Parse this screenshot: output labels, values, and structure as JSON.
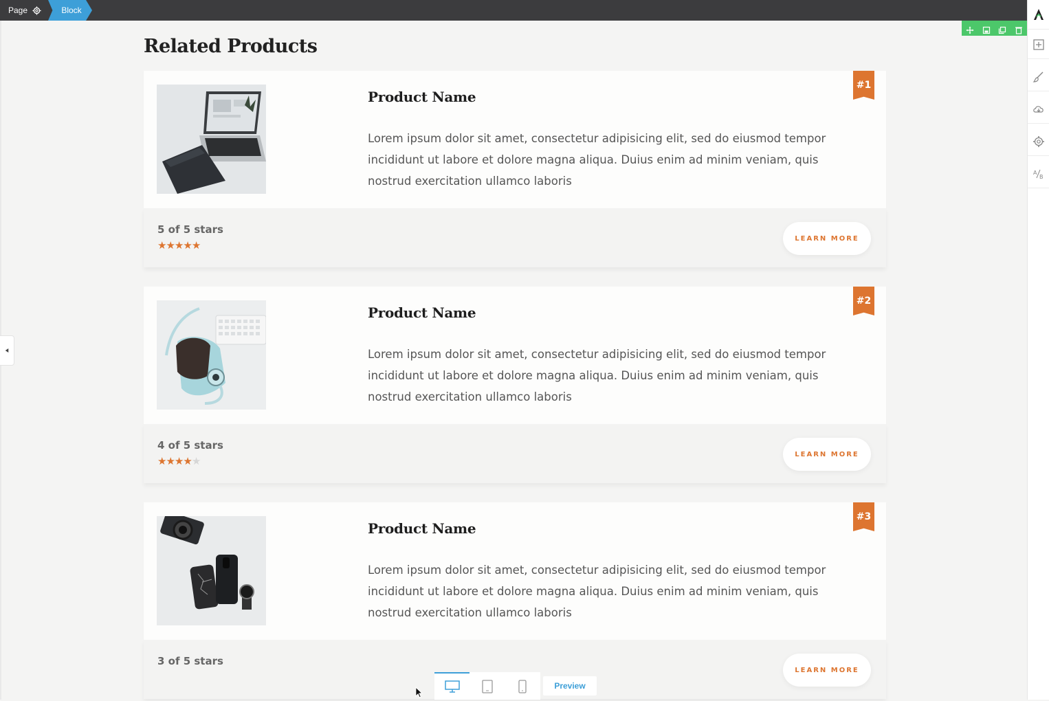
{
  "topbar": {
    "page_label": "Page",
    "block_label": "Block"
  },
  "section": {
    "title": "Related Products"
  },
  "products": [
    {
      "rank": "#1",
      "name": "Product Name",
      "description": "Lorem ipsum dolor sit amet, consectetur adipisicing elit, sed do eiusmod tempor incididunt ut labore et dolore magna aliqua. Duius enim ad minim veniam, quis nostrud exercitation ullamco laboris",
      "rating_label": "5 of 5 stars",
      "rating": 5,
      "max_rating": 5,
      "button": "LEARN MORE",
      "image": "laptop-notebook-image"
    },
    {
      "rank": "#2",
      "name": "Product Name",
      "description": "Lorem ipsum dolor sit amet, consectetur adipisicing elit, sed do eiusmod tempor incididunt ut labore et dolore magna aliqua. Duius enim ad minim veniam, quis nostrud exercitation ullamco laboris",
      "rating_label": "4 of 5 stars",
      "rating": 4,
      "max_rating": 5,
      "button": "LEARN MORE",
      "image": "instant-camera-image"
    },
    {
      "rank": "#3",
      "name": "Product Name",
      "description": "Lorem ipsum dolor sit amet, consectetur adipisicing elit, sed do eiusmod tempor incididunt ut labore et dolore magna aliqua. Duius enim ad minim veniam, quis nostrud exercitation ullamco laboris",
      "rating_label": "3 of 5 stars",
      "rating": 3,
      "max_rating": 5,
      "button": "LEARN MORE",
      "image": "camera-phones-watch-image"
    }
  ],
  "devicebar": {
    "devices": [
      "desktop-icon",
      "tablet-icon",
      "mobile-icon"
    ],
    "active": "desktop-icon",
    "preview_label": "Preview"
  },
  "sidebar": {
    "icons": [
      "logo-icon",
      "add-block-icon",
      "brush-icon",
      "cloud-download-icon",
      "settings-gear-icon",
      "ab-test-icon"
    ]
  },
  "colors": {
    "accent": "#dd7530",
    "blue": "#3d9fd8",
    "green": "#4cc76a",
    "topbar": "#3c3c3e"
  }
}
